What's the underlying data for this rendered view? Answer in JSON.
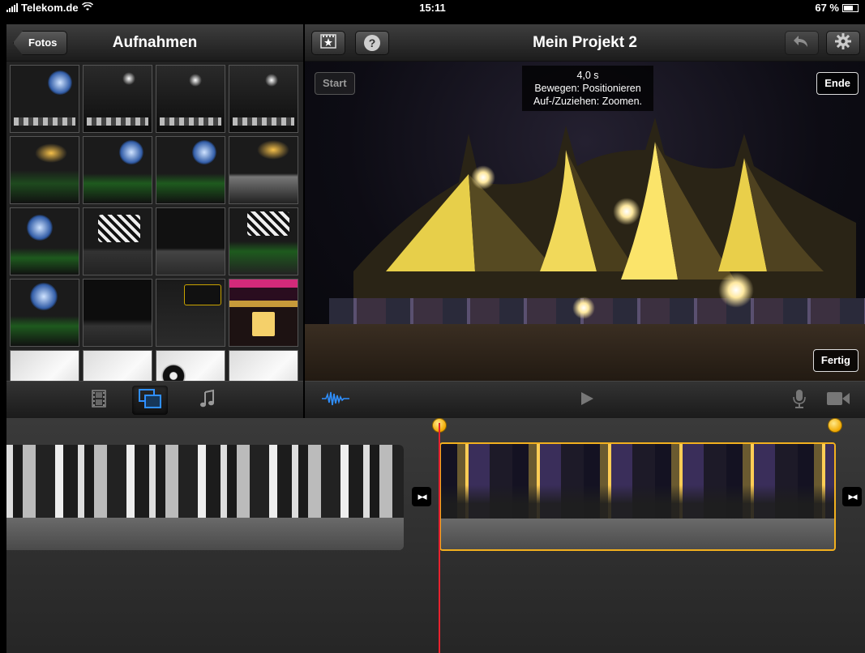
{
  "status_bar": {
    "carrier": "Telekom.de",
    "time": "15:11",
    "battery": "67 %",
    "battery_level": 0.67
  },
  "media_browser": {
    "back_label": "Fotos",
    "title": "Aufnahmen"
  },
  "project": {
    "title": "Mein Projekt 2"
  },
  "preview": {
    "start_label": "Start",
    "end_label": "Ende",
    "done_label": "Fertig",
    "info_duration": "4,0 s",
    "info_move": "Bewegen: Positionieren",
    "info_zoom": "Auf-/Zuziehen: Zoomen."
  },
  "help_label": "?",
  "colors": {
    "accent_blue": "#2f8fff",
    "clip_selection": "#f2b01e",
    "playhead": "#e8222e"
  }
}
